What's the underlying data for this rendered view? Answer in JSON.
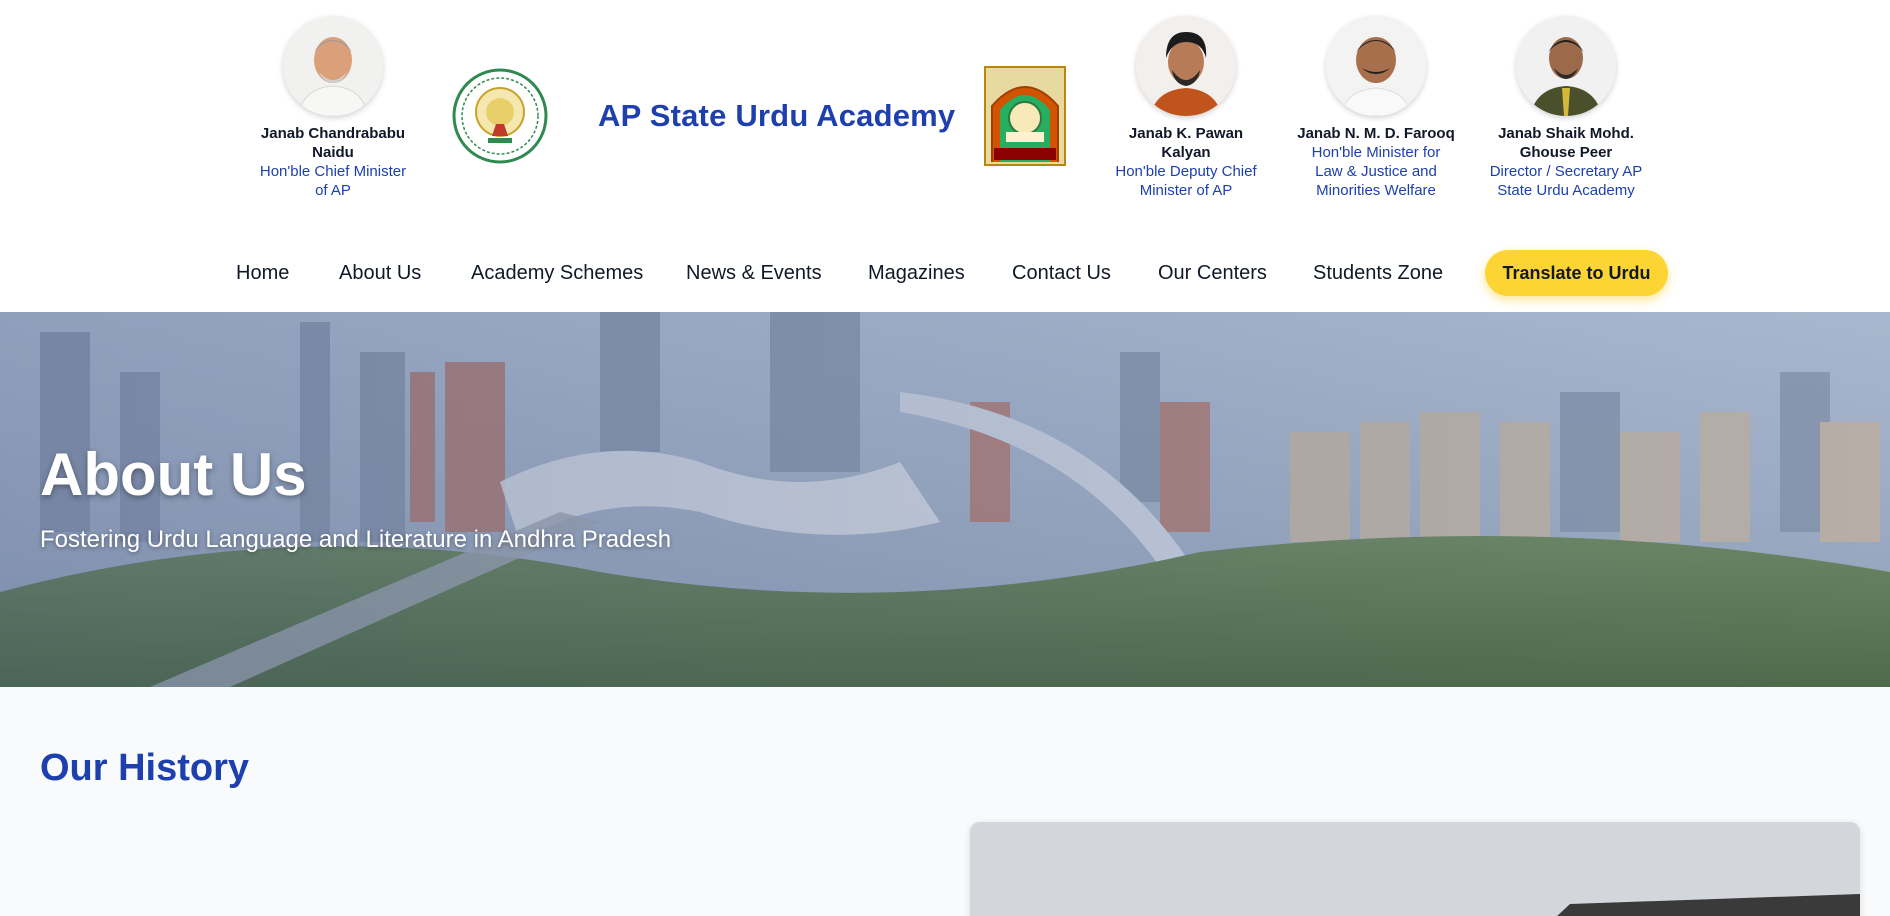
{
  "header": {
    "site_title": "AP State Urdu Academy",
    "leaders_left": [
      {
        "name": "Janab Chandrababu Naidu",
        "role": "Hon'ble Chief Minister of AP"
      }
    ],
    "leaders_right": [
      {
        "name": "Janab K. Pawan Kalyan",
        "role": "Hon'ble Deputy Chief Minister of AP"
      },
      {
        "name": "Janab N. M. D. Farooq",
        "role": "Hon'ble Minister for Law & Justice and Minorities Welfare"
      },
      {
        "name": "Janab Shaik Mohd. Ghouse Peer",
        "role": "Director / Secretary AP State Urdu Academy"
      }
    ],
    "seal_icon": "ap-government-seal-icon",
    "logo_icon": "urdu-academy-logo-icon"
  },
  "nav": {
    "items": [
      "Home",
      "About Us",
      "Academy Schemes",
      "News & Events",
      "Magazines",
      "Contact Us",
      "Our Centers",
      "Students Zone"
    ],
    "translate_label": "Translate to Urdu"
  },
  "hero": {
    "title": "About Us",
    "subtitle": "Fostering Urdu Language and Literature in Andhra Pradesh"
  },
  "content": {
    "section_title": "Our History"
  },
  "colors": {
    "brand_blue": "#1e40af",
    "button_yellow": "#fcd535",
    "section_bg": "#f8fafc"
  }
}
